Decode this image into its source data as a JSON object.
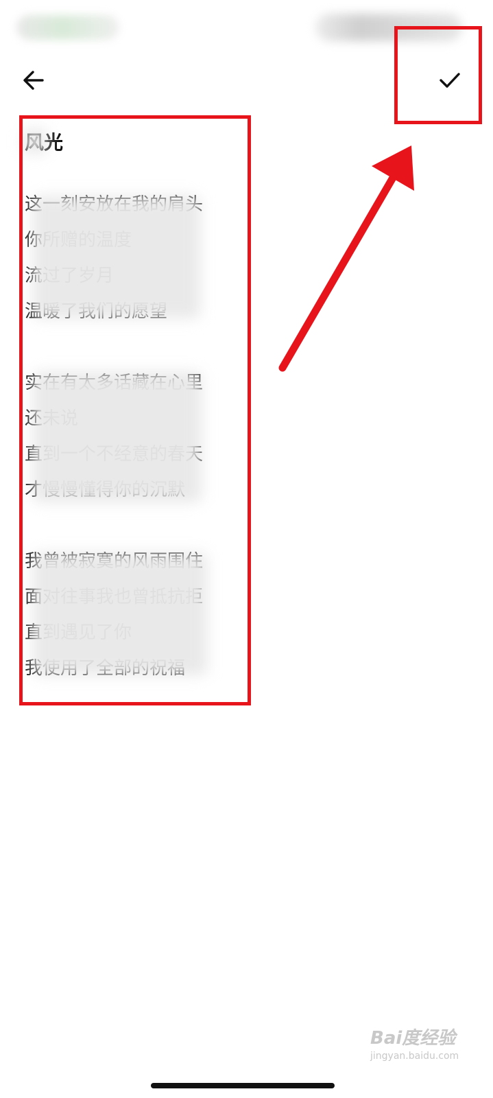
{
  "status_bar": {},
  "toolbar": {
    "back_icon": "arrow-left-icon",
    "confirm_icon": "check-icon"
  },
  "poem": {
    "title": "风光",
    "stanzas": [
      [
        "这一刻安放在我的肩头",
        "你所赠的温度",
        "流过了岁月",
        "温暖了我们的愿望"
      ],
      [
        "实在有太多话藏在心里",
        "还未说",
        "直到一个不经意的春天",
        "才慢慢懂得你的沉默"
      ],
      [
        "我曾被寂寞的风雨围住",
        "面对往事我也曾抵抗拒",
        "直到遇见了你",
        "我使用了全部的祝福"
      ]
    ]
  },
  "watermark": {
    "brand": "Bai度经验",
    "url": "jingyan.baidu.com"
  },
  "colors": {
    "annotation": "#e8141c",
    "text": "#111111"
  }
}
